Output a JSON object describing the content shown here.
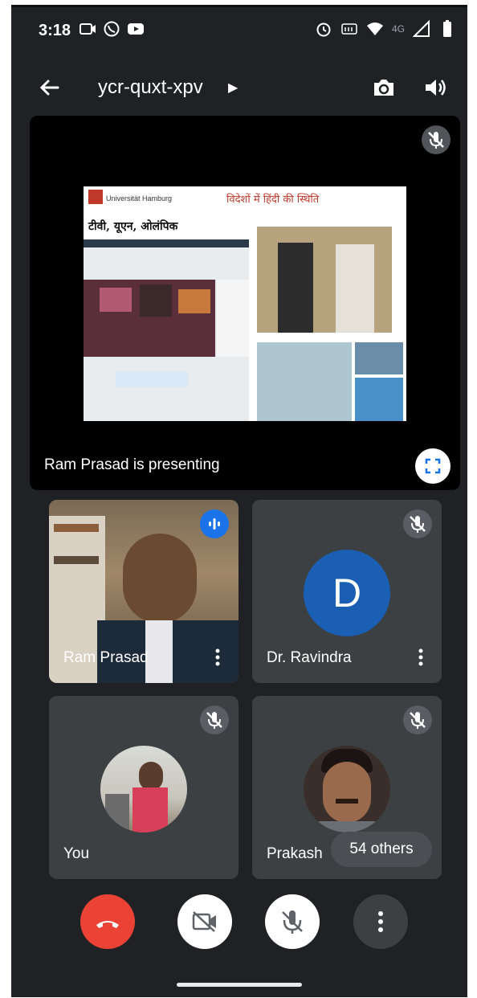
{
  "status_bar": {
    "time": "3:18",
    "network": "4G"
  },
  "meeting": {
    "code": "ycr-quxt-xpv"
  },
  "presentation": {
    "label": "Ram Prasad is presenting",
    "slide": {
      "university": "Universität Hamburg",
      "hindi_title": "विदेशों में हिंदी की स्थिति",
      "hindi_subtitle": "टीवी, यूएन, ओलंपिक"
    }
  },
  "participants": [
    {
      "name": "Ram Prasad",
      "speaking": true
    },
    {
      "name": "Dr. Ravindra",
      "initial": "D",
      "muted": true
    },
    {
      "name": "You",
      "muted": true
    },
    {
      "name": "Prakash",
      "muted": true
    }
  ],
  "others_count": "54 others",
  "colors": {
    "background": "#202124",
    "tile": "#3c4043",
    "end_call": "#ea4335",
    "avatar_blue": "#1a5fb4",
    "speaking_blue": "#1a73e8"
  }
}
